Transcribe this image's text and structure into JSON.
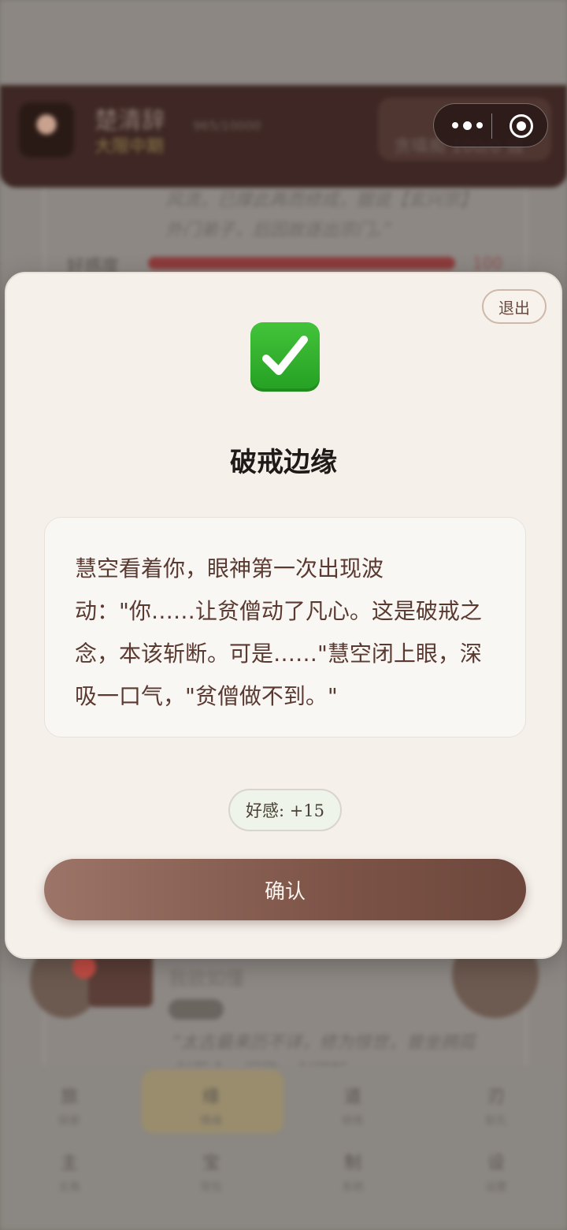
{
  "background": {
    "character_name": "楚清辞",
    "character_status": "大限中期",
    "stat_text": "965/10000",
    "badge_text": "贪嗔痴 100/0 毁",
    "quote_top": "风流，已撑此再而修成，据说【玄兴宗】外门弟子，后因故逐出宗门。”",
    "favor_label": "好感度",
    "favor_value": "100",
    "card_subtitle": "我欲如懂",
    "card_quote": "“太古最来历不详，修为惊世，曾坐拥孤剑至今，据称一剑可斩……",
    "nav": [
      {
        "icon": "旅",
        "label": "探索"
      },
      {
        "icon": "缘",
        "label": "情缘"
      },
      {
        "icon": "道",
        "label": "修炼"
      },
      {
        "icon": "刃",
        "label": "斩孔"
      },
      {
        "icon": "主",
        "label": "主角"
      },
      {
        "icon": "宝",
        "label": "背包"
      },
      {
        "icon": "制",
        "label": "系统"
      },
      {
        "icon": "设",
        "label": "设置"
      }
    ]
  },
  "capsule": {
    "more_icon": "more-dots-icon",
    "close_icon": "target-close-icon"
  },
  "modal": {
    "exit_label": "退出",
    "icon": "check-mark-icon",
    "icon_color": "#2fb12c",
    "title": "破戒边缘",
    "message": "慧空看着你，眼神第一次出现波动：\"你……让贫僧动了凡心。这是破戒之念，本该斩断。可是……\"慧空闭上眼，深吸一口气，\"贫僧做不到。\"",
    "favor_change": "好感: +15",
    "confirm_label": "确认"
  }
}
